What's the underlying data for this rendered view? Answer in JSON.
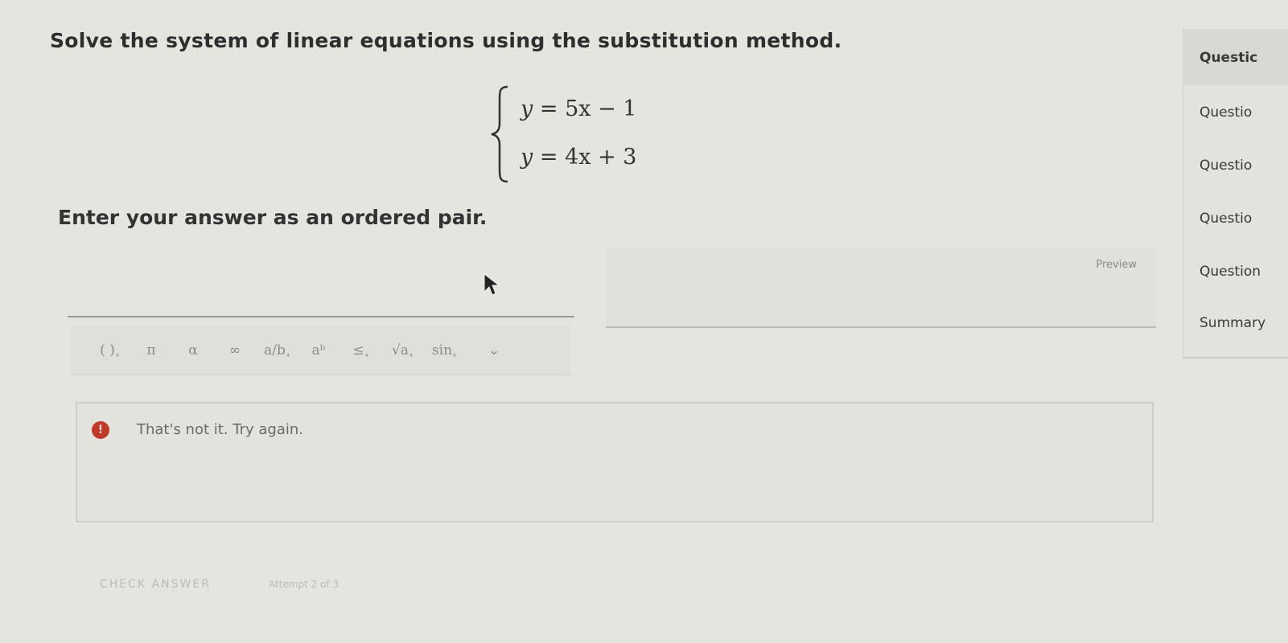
{
  "question": {
    "instruction": "Solve the system of linear equations using the substitution method.",
    "equations": [
      {
        "lhs": "y",
        "rhs": "5x − 1"
      },
      {
        "lhs": "y",
        "rhs": "4x + 3"
      }
    ],
    "prompt": "Enter your answer as an ordered pair."
  },
  "editor": {
    "toolbar": [
      {
        "name": "parentheses",
        "label": "( )",
        "sub": "⁴"
      },
      {
        "name": "pi",
        "label": "π"
      },
      {
        "name": "alpha",
        "label": "α"
      },
      {
        "name": "infinity",
        "label": "∞"
      },
      {
        "name": "fraction",
        "label": "a/b",
        "sub": "⁴"
      },
      {
        "name": "power",
        "label": "aᵇ"
      },
      {
        "name": "less-equal",
        "label": "≤",
        "sub": "⁴"
      },
      {
        "name": "sqrt",
        "label": "√a",
        "sub": "⁴"
      },
      {
        "name": "sin",
        "label": "sin",
        "sub": "⁴"
      }
    ],
    "dropdown": "⌄",
    "preview_label": "Preview"
  },
  "feedback": {
    "icon": "!",
    "message": "That's not it. Try again."
  },
  "footer": {
    "check_answer": "CHECK ANSWER",
    "attempt": "Attempt 2 of 3"
  },
  "sidebar": {
    "items": [
      {
        "label": "Questic",
        "active": true
      },
      {
        "label": "Questio",
        "active": false
      },
      {
        "label": "Questio",
        "active": false
      },
      {
        "label": "Questio",
        "active": false
      },
      {
        "label": "Question",
        "active": false
      },
      {
        "label": "Summary",
        "active": false
      }
    ]
  },
  "colors": {
    "background": "#e6e4df",
    "error": "#c0392b"
  },
  "icons": [
    "error-icon",
    "cursor-icon",
    "chevron-down-icon"
  ]
}
